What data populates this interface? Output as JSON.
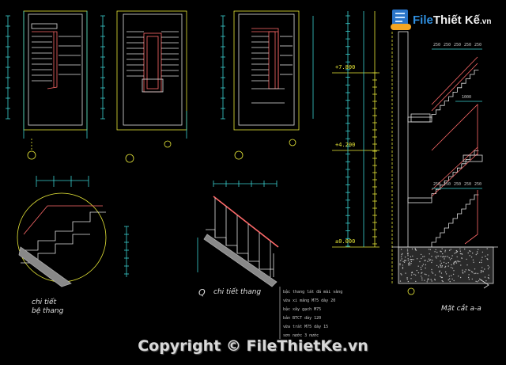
{
  "logo": {
    "brand_file": "File",
    "brand_rest": "Thiết Kế",
    "brand_tld": ".vn"
  },
  "copyright": "Copyright © FileThietKe.vn",
  "captions": {
    "detail_bottom_line1": "chi tiết",
    "detail_bottom_line2": "bệ thang",
    "detail_rail": "chi tiết thang",
    "detail_rail_marker": "Q",
    "section": "Mặt cắt a-a"
  },
  "levels": {
    "top": "+7.800",
    "mid": "+4.200",
    "base": "±0.000"
  },
  "section_dims": {
    "upper_run": "1000",
    "treads_upper": [
      "250",
      "250",
      "250",
      "250",
      "250"
    ],
    "treads_lower": [
      "250",
      "250",
      "250",
      "250",
      "250"
    ]
  },
  "notes": [
    "bậc thang lát đá mài vàng",
    "vữa xi măng M75 dày 20",
    "bậc xây gạch M75",
    "bản BTCT dày 120",
    "vữa trát M75 dày 15",
    "sơn nước 3 nước"
  ]
}
